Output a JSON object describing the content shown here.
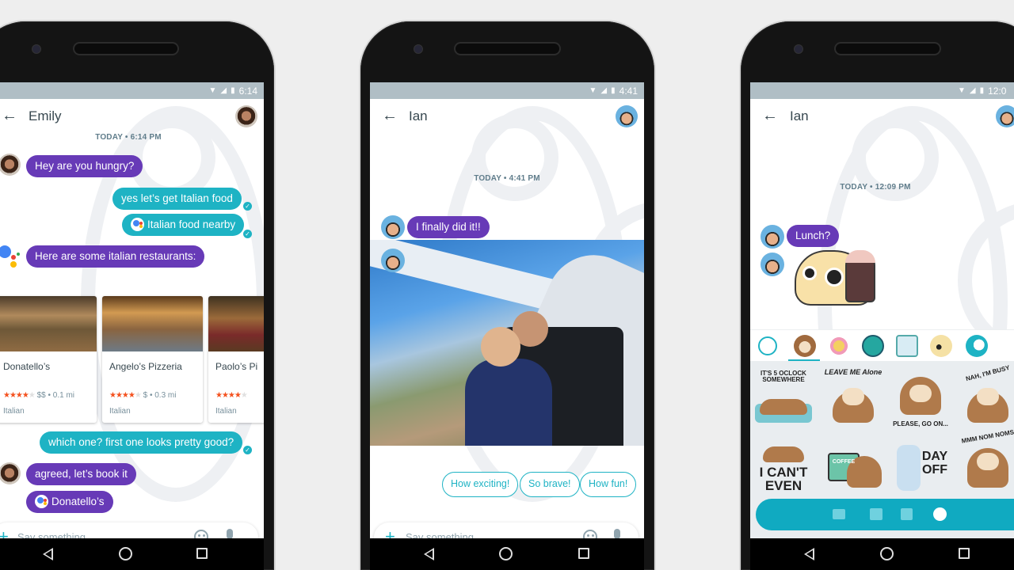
{
  "colors": {
    "purple_bubble": "#673ab7",
    "teal_bubble": "#1eb3c4",
    "status_bar": "#b0bec5",
    "background": "#eeeeee"
  },
  "phones": [
    {
      "status": {
        "time": "6:14",
        "icons": [
          "wifi-icon",
          "signal-icon",
          "battery-icon"
        ]
      },
      "contact": "Emily",
      "timestamp": "TODAY • 6:14 PM",
      "messages": [
        {
          "from": "Emily",
          "text": "Hey are you hungry?"
        },
        {
          "from": "me",
          "text": "yes let’s get Italian food"
        },
        {
          "from": "me",
          "text": "Italian food nearby",
          "assistant": true
        },
        {
          "from": "assistant",
          "text": "Here are some italian restaurants:"
        },
        {
          "from": "me",
          "text": "which one? first one looks pretty good?"
        },
        {
          "from": "Emily",
          "text": "agreed, let’s book it"
        },
        {
          "from": "Emily",
          "text": "Donatello’s",
          "assistant": true
        }
      ],
      "restaurants": [
        {
          "name": "Donatello’s",
          "stars": "★★★★",
          "stars_off": "★",
          "rating": 4,
          "price": "$$ • 0.1 mi",
          "category": "Italian"
        },
        {
          "name": "Angelo’s Pizzeria",
          "stars": "★★★★",
          "stars_off": "★",
          "rating": 4,
          "price": "$ • 0.3 mi",
          "category": "Italian"
        },
        {
          "name": "Paolo’s Pi",
          "stars": "★★★★",
          "stars_off": "★",
          "rating": 4,
          "price": "",
          "category": "Italian"
        }
      ],
      "compose_placeholder": "Say something..."
    },
    {
      "status": {
        "time": "4:41"
      },
      "contact": "Ian",
      "timestamp": "TODAY • 4:41 PM",
      "messages": [
        {
          "from": "Ian",
          "text": "I finally did it!!"
        },
        {
          "from": "Ian",
          "type": "photo",
          "description": "Tandem skydiving out of plane door"
        }
      ],
      "smart_replies": [
        "How exciting!",
        "So brave!",
        "How fun!"
      ],
      "compose_placeholder": "Say something..."
    },
    {
      "status": {
        "time": "12:0"
      },
      "contact": "Ian",
      "timestamp": "TODAY • 12:09 PM",
      "messages": [
        {
          "from": "Ian",
          "text": "Lunch?"
        },
        {
          "from": "Ian",
          "type": "sticker",
          "description": "taco character sticker"
        }
      ],
      "sticker_tabs": [
        "recent-icon",
        "sloth-pack",
        "dog-pack",
        "monster-pack",
        "robot-pack",
        "taco-pack",
        "add-sticker-pack-icon"
      ],
      "active_sticker_tab": 1,
      "stickers": [
        {
          "label": "IT'S 5 OCLOCK SOMEWHERE"
        },
        {
          "label": "LEAVE ME Alone"
        },
        {
          "label": "PLEASE, GO ON..."
        },
        {
          "label": "NAH, I'M BUSY"
        },
        {
          "label": "I CAN'T EVEN"
        },
        {
          "label": "COFFEE"
        },
        {
          "label": "DAY OFF"
        },
        {
          "label": "MMM NOM NOMS"
        }
      ],
      "keyboard_bar": [
        "keyboard-icon",
        "camera-icon",
        "gallery-icon",
        "sticker-icon"
      ]
    }
  ]
}
